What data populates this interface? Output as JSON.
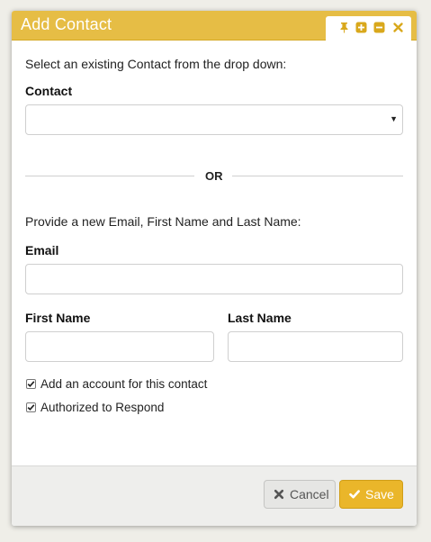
{
  "dialog": {
    "title": "Add Contact",
    "title_icons": [
      "pin-icon",
      "plus-icon",
      "minus-icon",
      "close-icon"
    ]
  },
  "existing": {
    "intro": "Select an existing Contact from the drop down:",
    "contact_label": "Contact",
    "contact_value": ""
  },
  "divider_text": "OR",
  "new_contact": {
    "intro": "Provide a new Email, First Name and Last Name:",
    "email_label": "Email",
    "email_value": "",
    "first_name_label": "First Name",
    "first_name_value": "",
    "last_name_label": "Last Name",
    "last_name_value": ""
  },
  "options": {
    "add_account_label": "Add an account for this contact",
    "add_account_checked": true,
    "authorized_label": "Authorized to Respond",
    "authorized_checked": true
  },
  "footer": {
    "cancel_label": "Cancel",
    "save_label": "Save"
  },
  "colors": {
    "accent": "#e6bd45",
    "save_button": "#eab62a",
    "icon_gold": "#d9a81c"
  }
}
